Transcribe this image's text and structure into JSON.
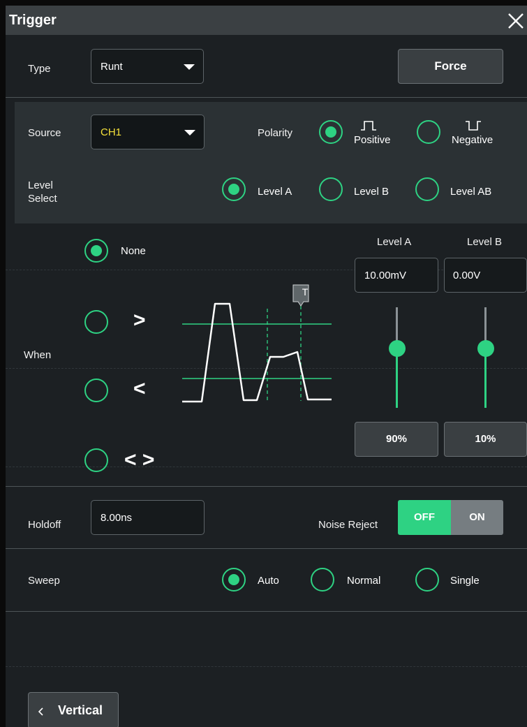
{
  "dialog": {
    "title": "Trigger",
    "close_icon": "close-icon"
  },
  "type": {
    "label": "Type",
    "value": "Runt"
  },
  "force_label": "Force",
  "source": {
    "label": "Source",
    "value": "CH1",
    "value_color": "#f5e13a"
  },
  "polarity": {
    "label": "Polarity",
    "options": [
      {
        "label": "Positive",
        "icon": "positive-pulse-icon",
        "selected": true
      },
      {
        "label": "Negative",
        "icon": "negative-pulse-icon",
        "selected": false
      }
    ]
  },
  "level_select": {
    "label_line1": "Level",
    "label_line2": "Select",
    "options": [
      {
        "label": "Level A",
        "selected": true
      },
      {
        "label": "Level B",
        "selected": false
      },
      {
        "label": "Level AB",
        "selected": false
      }
    ]
  },
  "when": {
    "label": "When",
    "options": [
      {
        "label": "None",
        "selected": true
      },
      {
        "symbol": ">",
        "selected": false
      },
      {
        "symbol": "<",
        "selected": false
      },
      {
        "symbol": "< >",
        "selected": false
      }
    ],
    "diagram_marker": "T"
  },
  "levels": {
    "a": {
      "label": "Level A",
      "value": "10.00mV",
      "percent_label": "90%",
      "slider_fraction": 0.59
    },
    "b": {
      "label": "Level B",
      "value": "0.00V",
      "percent_label": "10%",
      "slider_fraction": 0.59
    }
  },
  "holdoff": {
    "label": "Holdoff",
    "value": "8.00ns"
  },
  "noise_reject": {
    "label": "Noise Reject",
    "off_label": "OFF",
    "on_label": "ON",
    "state": "OFF"
  },
  "sweep": {
    "label": "Sweep",
    "options": [
      {
        "label": "Auto",
        "selected": true
      },
      {
        "label": "Normal",
        "selected": false
      },
      {
        "label": "Single",
        "selected": false
      }
    ]
  },
  "bottom_nav": {
    "back_icon": "chevron-left-icon",
    "label": "Vertical"
  },
  "colors": {
    "accent": "#2ed283",
    "background": "#1c2023",
    "titlebar": "#3b4043",
    "section": "#2b3134"
  }
}
